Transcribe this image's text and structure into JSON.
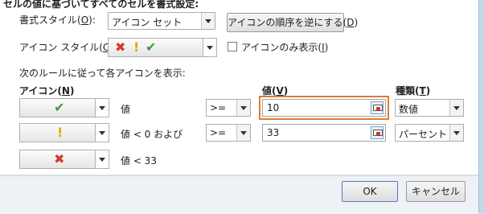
{
  "dialog": {
    "title_partial": "セルの値に基づいてすべてのセルを書式設定:",
    "format_style_label": "書式スタイル(",
    "format_style_key": "O",
    "format_style_label_end": "):",
    "format_style_value": "アイコン セット",
    "reverse_button_label": "アイコンの順序を逆にする(",
    "reverse_button_key": "D",
    "reverse_button_end": ")",
    "icon_style_label": "アイコン スタイル(",
    "icon_style_key": "C",
    "icon_style_end": "):",
    "icon_style_icons": [
      "cross-icon",
      "exclamation-icon",
      "check-icon"
    ],
    "show_icon_only_label": "アイコンのみ表示(",
    "show_icon_only_key": "I",
    "show_icon_only_end": ")",
    "show_icon_only_checked": false,
    "rules_heading": "次のルールに従って各アイコンを表示:",
    "col_icon_label": "アイコン(",
    "col_icon_key": "N",
    "col_icon_end": ")",
    "col_value_label": "値(",
    "col_value_key": "V",
    "col_value_end": ")",
    "col_type_label": "種類(",
    "col_type_key": "T",
    "col_type_end": ")",
    "rules": [
      {
        "icon": "check-icon",
        "condition": "値",
        "operator": ">=",
        "value": "10",
        "type": "数値",
        "focused": true
      },
      {
        "icon": "exclamation-icon",
        "condition": "値 < 0 および",
        "operator": ">=",
        "value": "33",
        "type": "パーセント",
        "focused": false
      },
      {
        "icon": "cross-icon",
        "condition": "値 < 33"
      }
    ],
    "ok_label": "OK",
    "cancel_label": "キャンセル"
  },
  "colors": {
    "focus_border": "#e07b31",
    "check": "#3c9a3a",
    "exclamation": "#e3a800",
    "cross": "#d23b2e"
  }
}
